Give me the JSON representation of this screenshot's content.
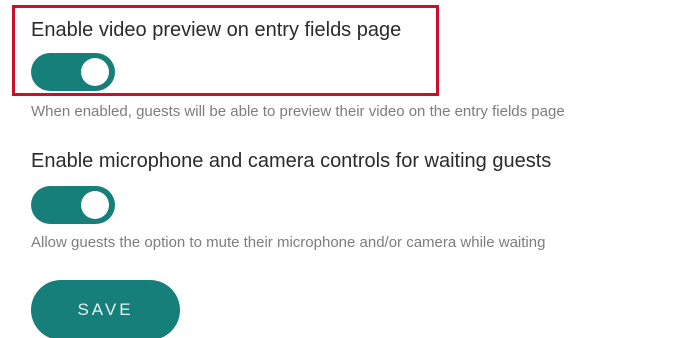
{
  "colors": {
    "accent": "#167f7a",
    "highlight": "#c8102e"
  },
  "settings": [
    {
      "title": "Enable video preview on entry fields page",
      "enabled": true,
      "help": "When enabled, guests will be able to preview their video on the entry fields page"
    },
    {
      "title": "Enable microphone and camera controls for waiting guests",
      "enabled": true,
      "help": "Allow guests the option to mute their microphone and/or camera while waiting"
    }
  ],
  "save_label": "SAVE"
}
